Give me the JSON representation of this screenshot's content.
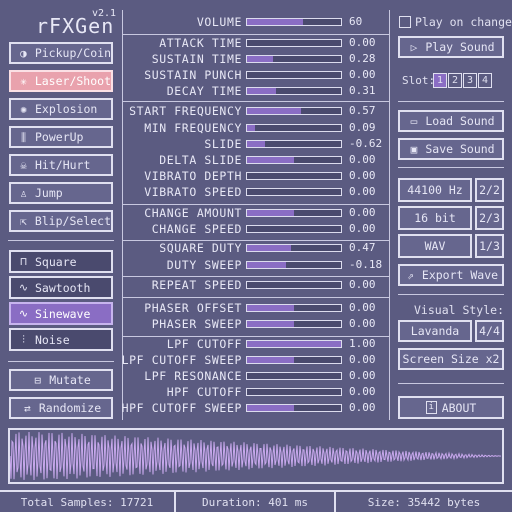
{
  "app": {
    "title": "rFXGen",
    "version": "v2.1"
  },
  "generators": [
    {
      "icon": "coin-icon",
      "glyph": "◑",
      "label": "Pickup/Coin",
      "selected": false
    },
    {
      "icon": "laser-icon",
      "glyph": "✳",
      "label": "Laser/Shoot",
      "selected": true
    },
    {
      "icon": "explosion-icon",
      "glyph": "✺",
      "label": "Explosion",
      "selected": false
    },
    {
      "icon": "powerup-icon",
      "glyph": "⫼",
      "label": "PowerUp",
      "selected": false
    },
    {
      "icon": "skull-icon",
      "glyph": "☠",
      "label": "Hit/Hurt",
      "selected": false
    },
    {
      "icon": "jump-icon",
      "glyph": "♙",
      "label": "Jump",
      "selected": false
    },
    {
      "icon": "blip-icon",
      "glyph": "⇱",
      "label": "Blip/Select",
      "selected": false
    }
  ],
  "waves": [
    {
      "icon": "square-wave-icon",
      "glyph": "⊓",
      "label": "Square",
      "selected": false
    },
    {
      "icon": "sawtooth-wave-icon",
      "glyph": "∿",
      "label": "Sawtooth",
      "selected": false
    },
    {
      "icon": "sine-wave-icon",
      "glyph": "∿",
      "label": "Sinewave",
      "selected": true
    },
    {
      "icon": "noise-wave-icon",
      "glyph": "⫶",
      "label": "Noise",
      "selected": false
    }
  ],
  "actions": {
    "mutate": "Mutate",
    "randomize": "Randomize"
  },
  "params": [
    {
      "label": "VOLUME",
      "value": "60",
      "fill": 0.6
    },
    {
      "label": "ATTACK TIME",
      "value": "0.00",
      "fill": 0
    },
    {
      "label": "SUSTAIN TIME",
      "value": "0.28",
      "fill": 0.28
    },
    {
      "label": "SUSTAIN PUNCH",
      "value": "0.00",
      "fill": 0
    },
    {
      "label": "DECAY TIME",
      "value": "0.31",
      "fill": 0.31
    },
    {
      "label": "START FREQUENCY",
      "value": "0.57",
      "fill": 0.57
    },
    {
      "label": "MIN FREQUENCY",
      "value": "0.09",
      "fill": 0.09
    },
    {
      "label": "SLIDE",
      "value": "-0.62",
      "fill": 0.19
    },
    {
      "label": "DELTA SLIDE",
      "value": "0.00",
      "fill": 0.5
    },
    {
      "label": "VIBRATO DEPTH",
      "value": "0.00",
      "fill": 0
    },
    {
      "label": "VIBRATO SPEED",
      "value": "0.00",
      "fill": 0
    },
    {
      "label": "CHANGE AMOUNT",
      "value": "0.00",
      "fill": 0.5
    },
    {
      "label": "CHANGE SPEED",
      "value": "0.00",
      "fill": 0
    },
    {
      "label": "SQUARE DUTY",
      "value": "0.47",
      "fill": 0.47
    },
    {
      "label": "DUTY SWEEP",
      "value": "-0.18",
      "fill": 0.41
    },
    {
      "label": "REPEAT SPEED",
      "value": "0.00",
      "fill": 0
    },
    {
      "label": "PHASER OFFSET",
      "value": "0.00",
      "fill": 0.5
    },
    {
      "label": "PHASER SWEEP",
      "value": "0.00",
      "fill": 0.5
    },
    {
      "label": "LPF CUTOFF",
      "value": "1.00",
      "fill": 1
    },
    {
      "label": "LPF CUTOFF SWEEP",
      "value": "0.00",
      "fill": 0.5
    },
    {
      "label": "LPF RESONANCE",
      "value": "0.00",
      "fill": 0
    },
    {
      "label": "HPF CUTOFF",
      "value": "0.00",
      "fill": 0
    },
    {
      "label": "HPF CUTOFF SWEEP",
      "value": "0.00",
      "fill": 0.5
    }
  ],
  "right": {
    "play_on_change": "Play on change",
    "play_sound": "Play Sound",
    "slot_label": "Slot:",
    "slots": [
      "1",
      "2",
      "3",
      "4"
    ],
    "active_slot": 0,
    "load_sound": "Load Sound",
    "save_sound": "Save Sound",
    "sample_rate": "44100 Hz",
    "sample_rate_idx": "2/2",
    "bit_depth": "16 bit",
    "bit_depth_idx": "2/3",
    "format": "WAV",
    "format_idx": "1/3",
    "export": "Export Wave",
    "visual_style_label": "Visual Style:",
    "style": "Lavanda",
    "style_idx": "4/4",
    "screen_size": "Screen Size x2",
    "about": "ABOUT"
  },
  "status": {
    "samples": "Total Samples: 17721",
    "duration": "Duration: 401 ms",
    "size": "Size: 35442 bytes"
  },
  "colors": {
    "background": "#5b5b81",
    "accent": "#8a6dc4",
    "selected": "#e9a2ad",
    "wave": "#c9a9ee"
  }
}
